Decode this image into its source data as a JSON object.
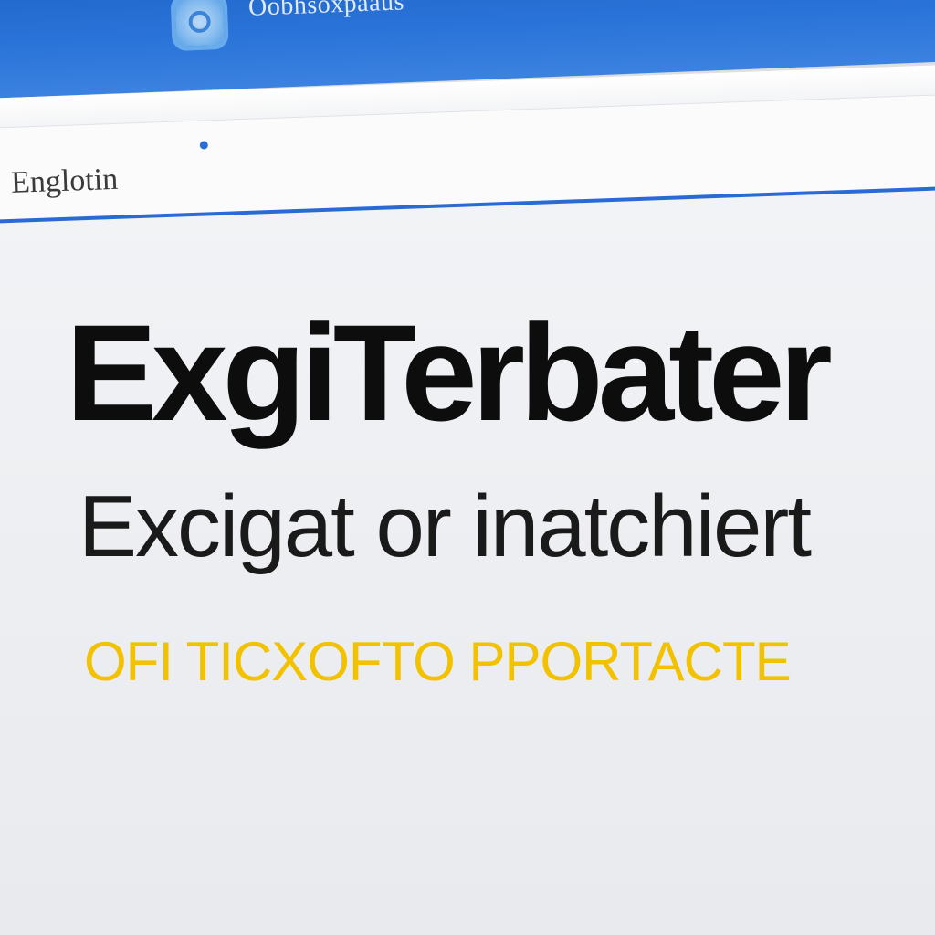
{
  "window": {
    "app_title": "Oobhsoxpaaus",
    "logo_icon": "app-logo-icon",
    "title_bar_color": "#2a73d8"
  },
  "address_bar": {
    "label": "Englotin",
    "accent_color": "#2a6ad4"
  },
  "main": {
    "headline": "ExgiTerbater",
    "subheadline": "Excigat or inatchiert",
    "tagline": "OFI TICXOFTO PPORTACTE",
    "tagline_color": "#f2c200"
  }
}
